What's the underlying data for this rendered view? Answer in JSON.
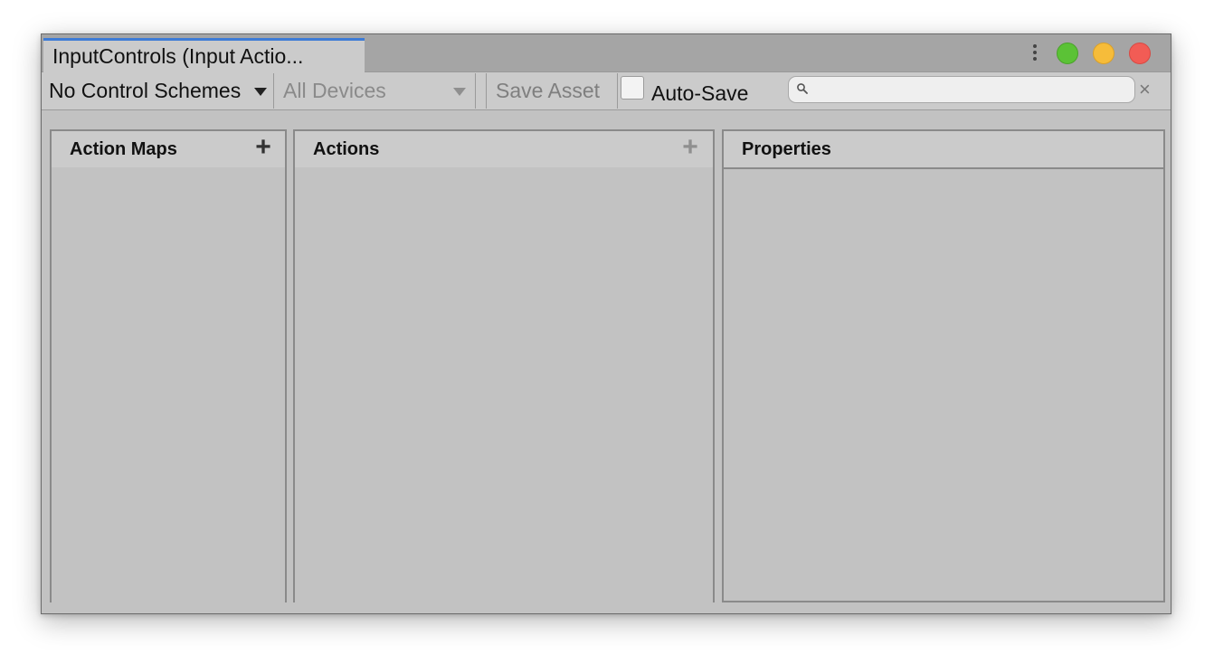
{
  "window": {
    "tab_title": "InputControls (Input Actio..."
  },
  "toolbar": {
    "control_scheme": "No Control Schemes",
    "devices": "All Devices",
    "save_asset": "Save Asset",
    "auto_save_label": "Auto-Save",
    "auto_save_checked": false,
    "search_value": "",
    "search_clear": "×"
  },
  "panes": {
    "action_maps": {
      "title": "Action Maps",
      "add": "+"
    },
    "actions": {
      "title": "Actions",
      "add": "+"
    },
    "properties": {
      "title": "Properties"
    }
  },
  "colors": {
    "tab_accent": "#3d7bd6",
    "close": "#f25c55",
    "minimize": "#f6bc3a",
    "maximize": "#5bc236"
  }
}
